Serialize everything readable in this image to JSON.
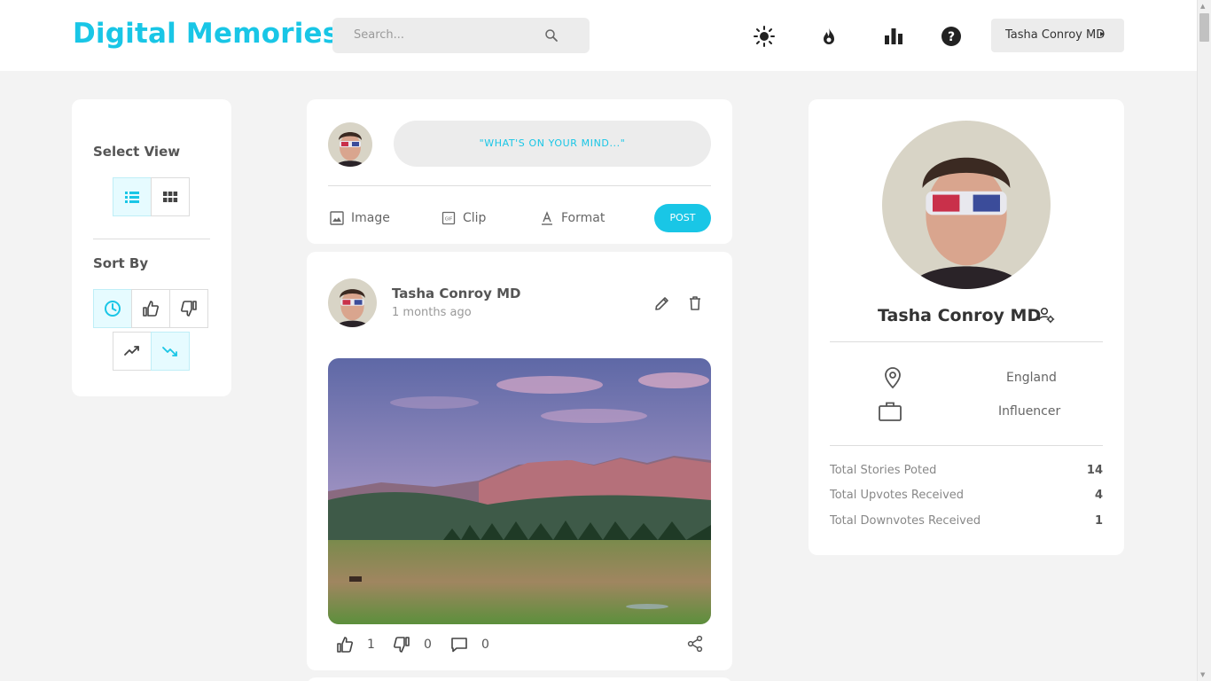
{
  "app": {
    "title": "Digital Memories"
  },
  "search": {
    "placeholder": "Search..."
  },
  "header": {
    "icons": [
      "sun-icon",
      "flame-icon",
      "bar-chart-icon",
      "help-icon"
    ],
    "user_button": "Tasha Conroy MD"
  },
  "left_panel": {
    "select_view_title": "Select View",
    "view_options": [
      "list",
      "grid"
    ],
    "selected_view": "list",
    "sort_by_title": "Sort By",
    "sort_options": [
      "recent",
      "upvotes",
      "downvotes",
      "trending-up",
      "trending-down"
    ],
    "selected_sort": [
      "recent",
      "trending-down"
    ]
  },
  "composer": {
    "prompt": "\"WHAT'S ON YOUR MIND...\"",
    "tools": {
      "image": "Image",
      "clip": "Clip",
      "format": "Format"
    },
    "post_label": "POST"
  },
  "post": {
    "author": "Tasha Conroy MD",
    "time": "1 months ago",
    "upvotes": "1",
    "downvotes": "0",
    "comments": "0"
  },
  "profile": {
    "name": "Tasha Conroy MD",
    "location": "England",
    "occupation": "Influencer",
    "stats": [
      {
        "label": "Total Stories Poted",
        "value": "14"
      },
      {
        "label": "Total Upvotes Received",
        "value": "4"
      },
      {
        "label": "Total Downvotes Received",
        "value": "1"
      }
    ]
  },
  "colors": {
    "accent": "#19c6e6",
    "background": "#f3f3f3",
    "card": "#ffffff"
  }
}
